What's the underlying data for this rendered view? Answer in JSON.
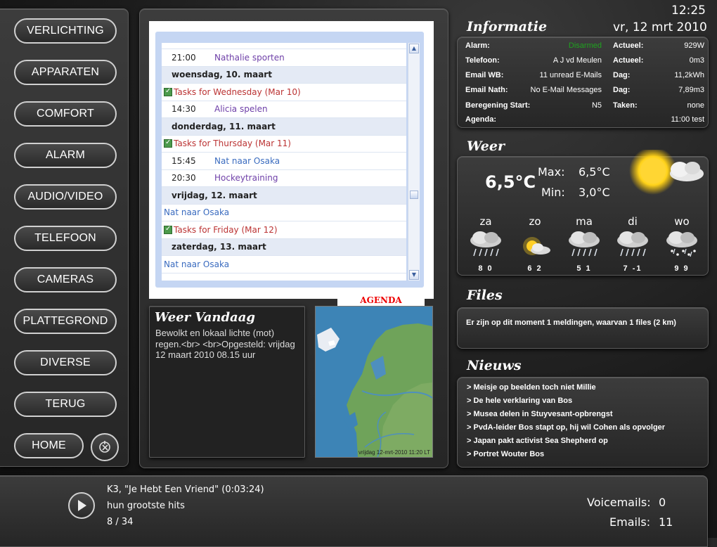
{
  "menu": {
    "items": [
      "VERLICHTING",
      "APPARATEN",
      "COMFORT",
      "ALARM",
      "AUDIO/VIDEO",
      "TELEFOON",
      "CAMERAS",
      "PLATTEGROND",
      "DIVERSE",
      "TERUG"
    ],
    "home": "HOME"
  },
  "agenda": {
    "rows": [
      {
        "kind": "event",
        "time": "21:00",
        "text": "Nathalie sporten",
        "color": "purple"
      },
      {
        "kind": "day",
        "text": "woensdag, 10. maart"
      },
      {
        "kind": "task",
        "text": "Tasks for Wednesday (Mar 10)"
      },
      {
        "kind": "event",
        "time": "14:30",
        "text": "Alicia spelen",
        "color": "purple"
      },
      {
        "kind": "day",
        "text": "donderdag, 11. maart"
      },
      {
        "kind": "task",
        "text": "Tasks for Thursday (Mar 11)"
      },
      {
        "kind": "event",
        "time": "15:45",
        "text": "Nat naar Osaka",
        "color": "blue"
      },
      {
        "kind": "event",
        "time": "20:30",
        "text": "Hockeytraining",
        "color": "purple"
      },
      {
        "kind": "day",
        "text": "vrijdag, 12. maart"
      },
      {
        "kind": "allday",
        "text": "Nat naar Osaka"
      },
      {
        "kind": "task",
        "text": "Tasks for Friday (Mar 12)"
      },
      {
        "kind": "day",
        "text": "zaterdag, 13. maart"
      },
      {
        "kind": "allday",
        "text": "Nat naar Osaka"
      }
    ],
    "label": "AGENDA"
  },
  "weer_vandaag": {
    "title": "Weer Vandaag",
    "text": "Bewolkt en lokaal lichte (mot) regen.<br>  <br>Opgesteld: vrijdag 12 maart 2010 08.15 uur",
    "map_time": "vrijdag 12-mrt-2010 11:20 LT"
  },
  "header": {
    "time": "12:25",
    "date": "vr,  12 mrt 2010"
  },
  "informatie": {
    "title": "Informatie",
    "left": [
      {
        "k": "Alarm:",
        "v": "Disarmed",
        "color": "#1fa31f"
      },
      {
        "k": "Telefoon:",
        "v": "A J vd Meulen"
      },
      {
        "k": "Email WB:",
        "v": "11 unread E-Mails"
      },
      {
        "k": "Email Nath:",
        "v": "No E-Mail Messages"
      },
      {
        "k": "Beregening Start:",
        "v": "N5"
      },
      {
        "k": "Agenda:",
        "v": "11:00  test"
      }
    ],
    "right": [
      {
        "k": "Actueel:",
        "v": "929W"
      },
      {
        "k": "Actueel:",
        "v": "0m3"
      },
      {
        "k": "Dag:",
        "v": "11,2kWh"
      },
      {
        "k": "Dag:",
        "v": "7,89m3"
      },
      {
        "k": "Taken:",
        "v": "none"
      }
    ]
  },
  "weer": {
    "title": "Weer",
    "current": "6,5°C",
    "max_label": "Max:",
    "max": "6,5°C",
    "min_label": "Min:",
    "min": "3,0°C",
    "forecast": [
      {
        "day": "za",
        "temps": "8 0",
        "icon": "rain-icon"
      },
      {
        "day": "zo",
        "temps": "6 2",
        "icon": "sun-cloud-icon"
      },
      {
        "day": "ma",
        "temps": "5 1",
        "icon": "rain-icon"
      },
      {
        "day": "di",
        "temps": "7 -1",
        "icon": "rain-icon"
      },
      {
        "day": "wo",
        "temps": "9 9",
        "icon": "snow-rain-icon"
      }
    ]
  },
  "files": {
    "title": "Files",
    "text": "Er zijn op dit moment 1 meldingen, waarvan 1 files (2 km)"
  },
  "nieuws": {
    "title": "Nieuws",
    "items": [
      "> Meisje op beelden toch niet Millie",
      "> De hele verklaring van Bos",
      "> Musea delen in Stuyvesant-opbrengst",
      "> PvdA-leider Bos stapt op, hij wil Cohen als opvolger",
      "> Japan pakt activist Sea Shepherd op",
      "> Portret Wouter Bos"
    ]
  },
  "player": {
    "track": "K3, \"Je Hebt Een Vriend\" (0:03:24)",
    "album": "hun grootste hits",
    "position": "8 / 34"
  },
  "counters": {
    "voicemails_label": "Voicemails:",
    "voicemails": "0",
    "emails_label": "Emails:",
    "emails": "11"
  }
}
